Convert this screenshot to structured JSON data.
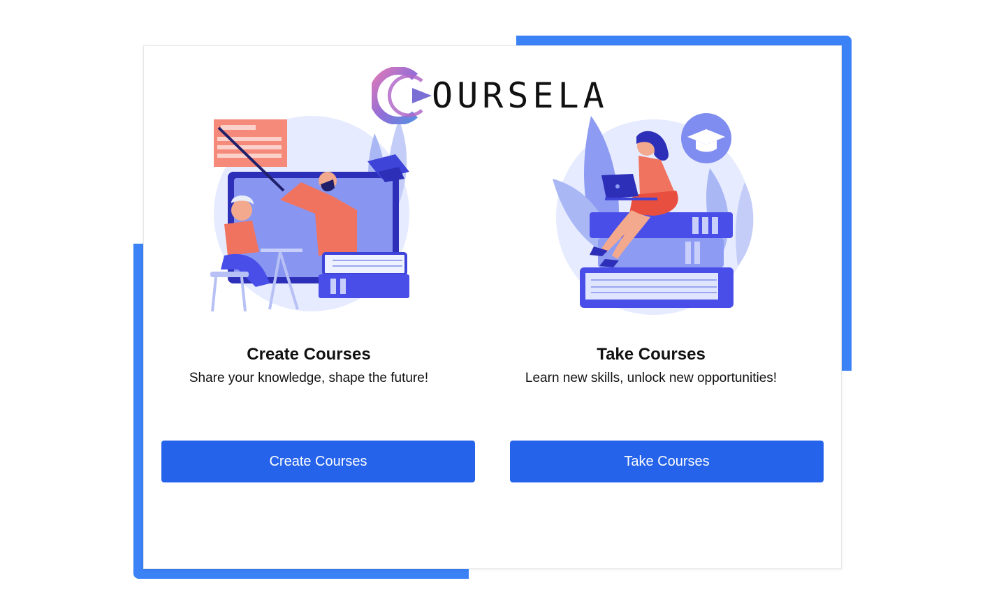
{
  "brand": {
    "logo_text": "OURSELA",
    "logo_icon": "c-ring-logo-icon",
    "gradient": [
      "#e07ab8",
      "#7b6fd6",
      "#5b8ee0"
    ]
  },
  "colors": {
    "frame_accent": "#3b82f6",
    "button_bg": "#2563eb",
    "button_text": "#ffffff",
    "illus_primary": "#5b5cf0",
    "illus_coral": "#f0735f",
    "illus_light": "#dfe6ff"
  },
  "options": [
    {
      "title": "Create Courses",
      "subtitle": "Share your knowledge, shape the future!",
      "button_label": "Create Courses",
      "illustration_icon": "teacher-presenting-icon"
    },
    {
      "title": "Take Courses",
      "subtitle": "Learn new skills, unlock new opportunities!",
      "button_label": "Take Courses",
      "illustration_icon": "student-on-books-icon"
    }
  ]
}
